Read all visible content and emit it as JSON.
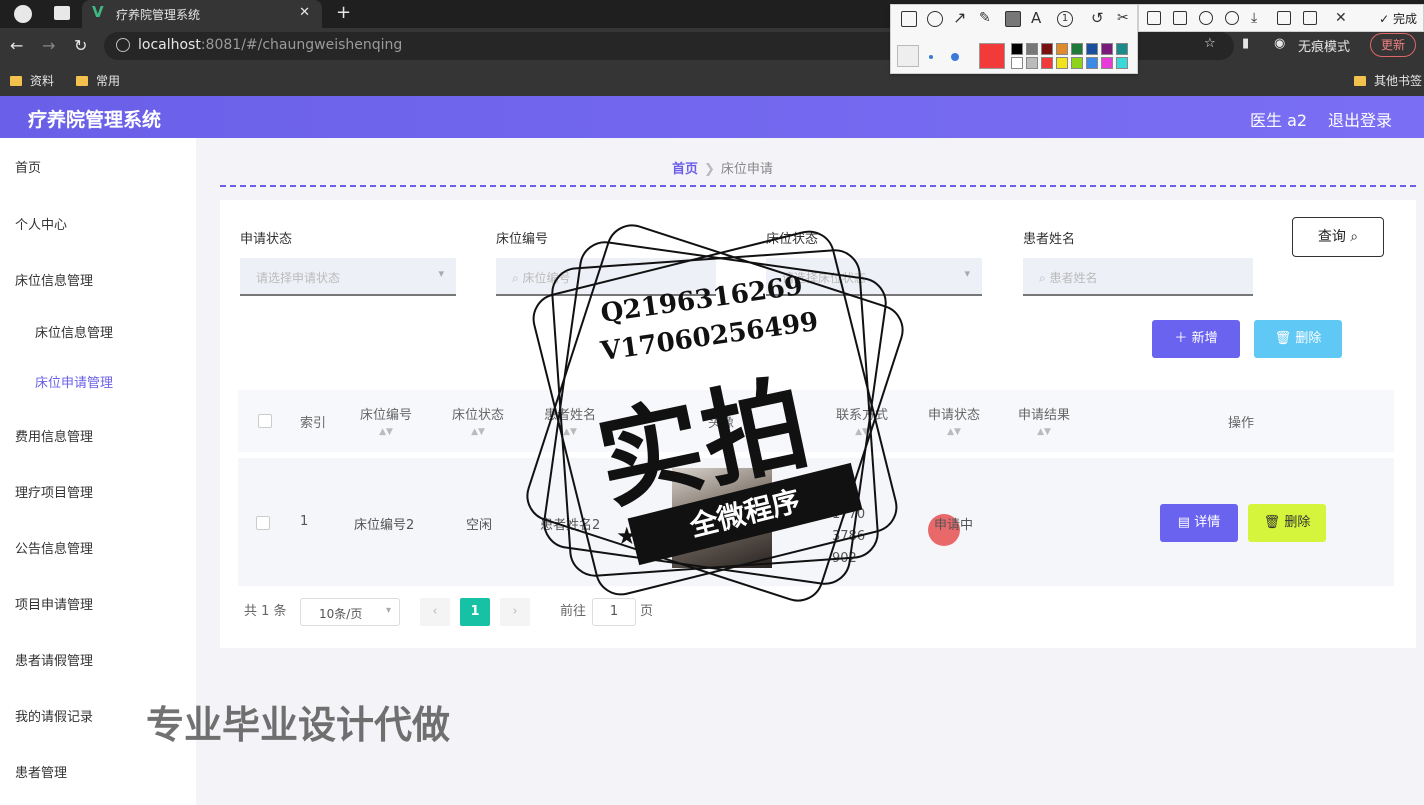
{
  "browser": {
    "tab_title": "疗养院管理系统",
    "url_host": "localhost",
    "url_rest": ":8081/#/chaungweishenqing",
    "incognito_label": "无痕模式",
    "update_label": "更新",
    "bookmarks": [
      "资料",
      "常用"
    ],
    "other_bookmarks": "其他书签"
  },
  "annotation_toolbar": {
    "done_label": "完成"
  },
  "header": {
    "title": "疗养院管理系统",
    "user": "医生 a2",
    "logout": "退出登录"
  },
  "sidebar": {
    "items": [
      "首页",
      "个人中心",
      "床位信息管理",
      "床位信息管理",
      "床位申请管理",
      "费用信息管理",
      "理疗项目管理",
      "公告信息管理",
      "项目申请管理",
      "患者请假管理",
      "我的请假记录",
      "患者管理"
    ]
  },
  "breadcrumb": {
    "home": "首页",
    "current": "床位申请"
  },
  "filters": {
    "apply_status": {
      "label": "申请状态",
      "placeholder": "请选择申请状态"
    },
    "bed_no": {
      "label": "床位编号",
      "placeholder": "床位编号"
    },
    "bed_status": {
      "label": "床位状态",
      "placeholder": "请选择床位状态"
    },
    "patient_name": {
      "label": "患者姓名",
      "placeholder": "患者姓名"
    },
    "search_label": "查询"
  },
  "actions": {
    "add_label": "新增",
    "delete_label": "删除"
  },
  "table": {
    "columns": [
      "索引",
      "床位编号",
      "床位状态",
      "患者姓名",
      "头像",
      "联系方式",
      "申请状态",
      "申请结果",
      "操作"
    ],
    "rows": [
      {
        "index": "1",
        "bed_no": "床位编号2",
        "bed_status": "空闲",
        "patient": "患者姓名2",
        "phone": "17703786902",
        "apply_status": "申请中",
        "result": "",
        "detail_label": "详情",
        "delete_label": "删除"
      }
    ]
  },
  "pagination": {
    "total": "共 1 条",
    "page_size": "10条/页",
    "current_page": "1",
    "goto_prefix": "前往",
    "goto_value": "1",
    "goto_suffix": "页"
  },
  "watermark": {
    "qq": "Q2196316269",
    "wechat": "V17060256499",
    "big": "实拍",
    "ribbon": "全微程序",
    "footer": "专业毕业设计代做"
  },
  "colors": {
    "header": "#6b5fe8",
    "primary_button": "#6a63f0",
    "delete_button": "#60c8f5",
    "row_delete": "#d4f53c",
    "page_current": "#16c2a3"
  }
}
